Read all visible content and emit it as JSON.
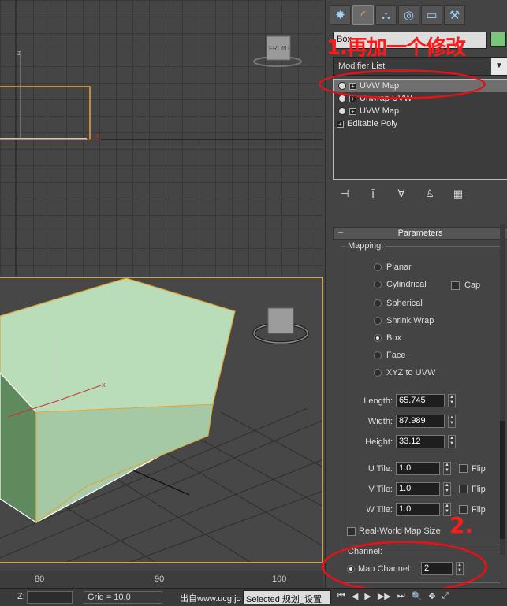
{
  "command_panel": {
    "tabs": [
      {
        "name": "create-tab",
        "glyph": "✸"
      },
      {
        "name": "modify-tab",
        "glyph": "◜"
      },
      {
        "name": "hierarchy-tab",
        "glyph": "⛬"
      },
      {
        "name": "motion-tab",
        "glyph": "◎"
      },
      {
        "name": "display-tab",
        "glyph": "▭"
      },
      {
        "name": "utilities-tab",
        "glyph": "⚒"
      }
    ],
    "object_name": "Box",
    "object_color": "#7bc47b",
    "modifier_list_label": "Modifier List",
    "stack": [
      "UVW Map",
      "Unwrap UVW",
      "UVW Map",
      "Editable Poly"
    ],
    "rollout_title": "Parameters",
    "mapping_label": "Mapping:",
    "mapping_options": [
      "Planar",
      "Cylindrical",
      "Spherical",
      "Shrink Wrap",
      "Box",
      "Face",
      "XYZ to UVW"
    ],
    "mapping_selected": "Box",
    "cap_label": "Cap",
    "length_label": "Length:",
    "length_value": "65.745",
    "width_label": "Width:",
    "width_value": "87.989",
    "height_label": "Height:",
    "height_value": "33.12",
    "utile_label": "U Tile:",
    "utile_value": "1.0",
    "vtile_label": "V Tile:",
    "vtile_value": "1.0",
    "wtile_label": "W Tile:",
    "wtile_value": "1.0",
    "flip_label": "Flip",
    "real_world_label": "Real-World Map Size",
    "channel_label": "Channel:",
    "map_channel_label": "Map Channel:",
    "map_channel_value": "2"
  },
  "annotations": {
    "note1": "1.再加一个修改",
    "note2": "2.",
    "color": "#ff1a1a"
  },
  "viewports": {
    "front_cube_label": "FRONT",
    "axis_x": "x",
    "axis_z": "z"
  },
  "timeline": {
    "ticks": [
      "80",
      "90",
      "100"
    ]
  },
  "status": {
    "z_label": "Z:",
    "grid_text": "Grid = 10.0",
    "watermark": "出自www.ucg.jo",
    "selected_text": "Selected 规划_设置",
    "selected_border_color": "#ddd"
  }
}
